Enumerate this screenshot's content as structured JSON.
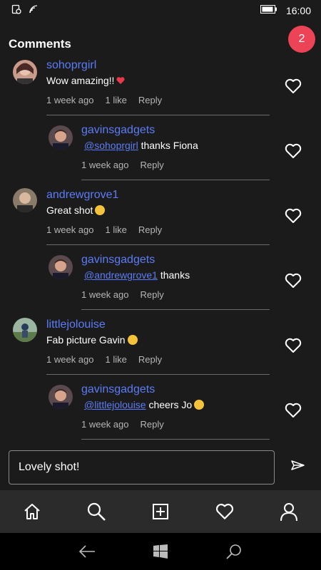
{
  "status_bar": {
    "time": "16:00"
  },
  "header": {
    "title": "Comments",
    "badge_count": "2"
  },
  "comments": [
    {
      "username": "sohoprgirl",
      "mention": "",
      "text": "Wow amazing!!",
      "time": "1 week ago",
      "likes": "1 like",
      "reply": "Reply",
      "avatar": "woman-avatar"
    },
    {
      "username": "gavinsgadgets",
      "mention": "@sohoprgirl",
      "text": " thanks Fiona",
      "time": "1 week ago",
      "likes": "",
      "reply": "Reply",
      "avatar": "man-avatar"
    },
    {
      "username": "andrewgrove1",
      "mention": "",
      "text": "Great shot",
      "time": "1 week ago",
      "likes": "1 like",
      "reply": "Reply",
      "avatar": "older-man-avatar"
    },
    {
      "username": "gavinsgadgets",
      "mention": "@andrewgrove1",
      "text": " thanks",
      "time": "1 week ago",
      "likes": "",
      "reply": "Reply",
      "avatar": "man-avatar"
    },
    {
      "username": "littlejolouise",
      "mention": "",
      "text": "Fab picture Gavin",
      "time": "1 week ago",
      "likes": "1 like",
      "reply": "Reply",
      "avatar": "outdoor-avatar"
    },
    {
      "username": "gavinsgadgets",
      "mention": "@littlejolouise",
      "text": " cheers Jo",
      "time": "1 week ago",
      "likes": "",
      "reply": "Reply",
      "avatar": "man-avatar"
    }
  ],
  "input": {
    "value": "Lovely shot!"
  },
  "colors": {
    "accent": "#5b7cf6",
    "badge": "#ec4356",
    "background": "#1b1b1b",
    "nav": "#2b2b2b"
  },
  "nav_icons": [
    "home-icon",
    "search-icon",
    "add-post-icon",
    "heart-icon",
    "profile-icon"
  ],
  "system_icons": [
    "back-icon",
    "windows-icon",
    "cortana-search-icon"
  ]
}
